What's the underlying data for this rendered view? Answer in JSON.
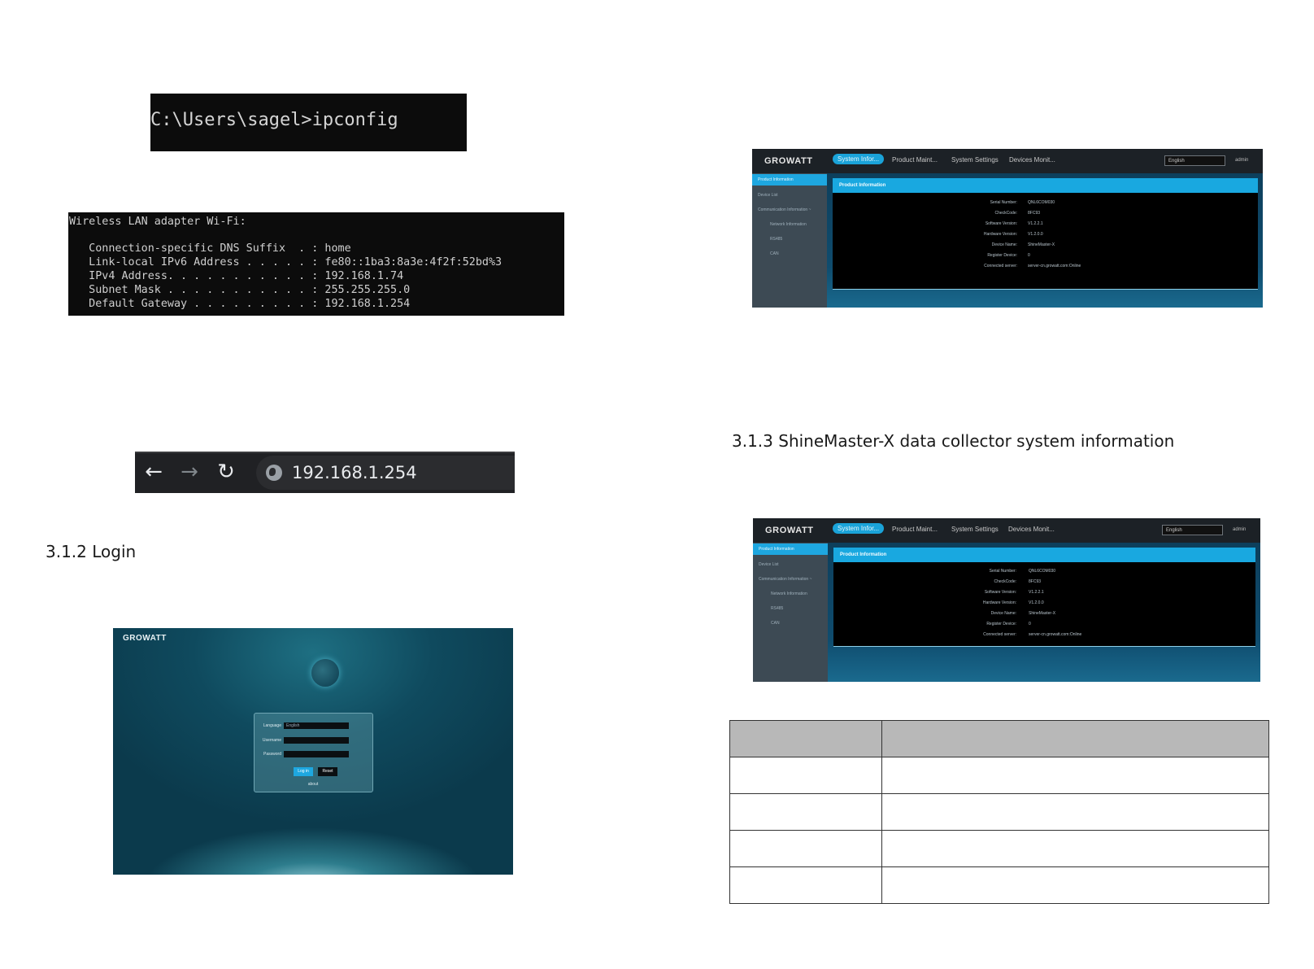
{
  "ipconfig_command": {
    "prompt_line": "C:\\Users\\sagel>ipconfig"
  },
  "ipconfig_output": {
    "adapter_title": "Wireless LAN adapter Wi-Fi:",
    "rows": [
      "   Connection-specific DNS Suffix  . : home",
      "   Link-local IPv6 Address . . . . . : fe80::1ba3:8a3e:4f2f:52bd%3",
      "   IPv4 Address. . . . . . . . . . . : 192.168.1.74",
      "   Subnet Mask . . . . . . . . . . . : 255.255.255.0",
      "   Default Gateway . . . . . . . . . : 192.168.1.254"
    ]
  },
  "browser": {
    "back_glyph": "←",
    "forward_glyph": "→",
    "reload_glyph": "↻",
    "url": "192.168.1.254"
  },
  "headings": {
    "login": "3.1.2 Login",
    "system_info": "3.1.3 ShineMaster-X data collector system information"
  },
  "login_screen": {
    "brand": "GROWATT",
    "labels": [
      "Language",
      "Username",
      "Password"
    ],
    "language_value": "English",
    "login_button": "Log in",
    "reset_button": "Reset",
    "footer_link": "about"
  },
  "app": {
    "brand": "GROWATT",
    "tabs": [
      "System Infor...",
      "Product Maint...",
      "System Settings",
      "Devices Monit..."
    ],
    "language": "English",
    "admin": "admin",
    "sidebar": [
      {
        "label": "Product Information",
        "active": true,
        "sub": false
      },
      {
        "label": "Device List",
        "active": false,
        "sub": false
      },
      {
        "label": "Communication Information ~",
        "active": false,
        "sub": false
      },
      {
        "label": "Network Information",
        "active": false,
        "sub": true
      },
      {
        "label": "RS485",
        "active": false,
        "sub": true
      },
      {
        "label": "CAN",
        "active": false,
        "sub": true
      }
    ],
    "section_title": "Product Information",
    "fields": [
      {
        "key": "Serial Number:",
        "value": "QNL6COM030"
      },
      {
        "key": "CheckCode:",
        "value": "8FC93"
      },
      {
        "key": "Software Version:",
        "value": "V1.2.2.1"
      },
      {
        "key": "Hardware Version:",
        "value": "V1.2.0.0"
      },
      {
        "key": "Device Name:",
        "value": "ShineMaster-X"
      },
      {
        "key": "Register Device:",
        "value": "0"
      },
      {
        "key": "Connected server:",
        "value": "server-cn.growatt.com:Online"
      }
    ]
  },
  "table": {
    "rows": 4
  }
}
